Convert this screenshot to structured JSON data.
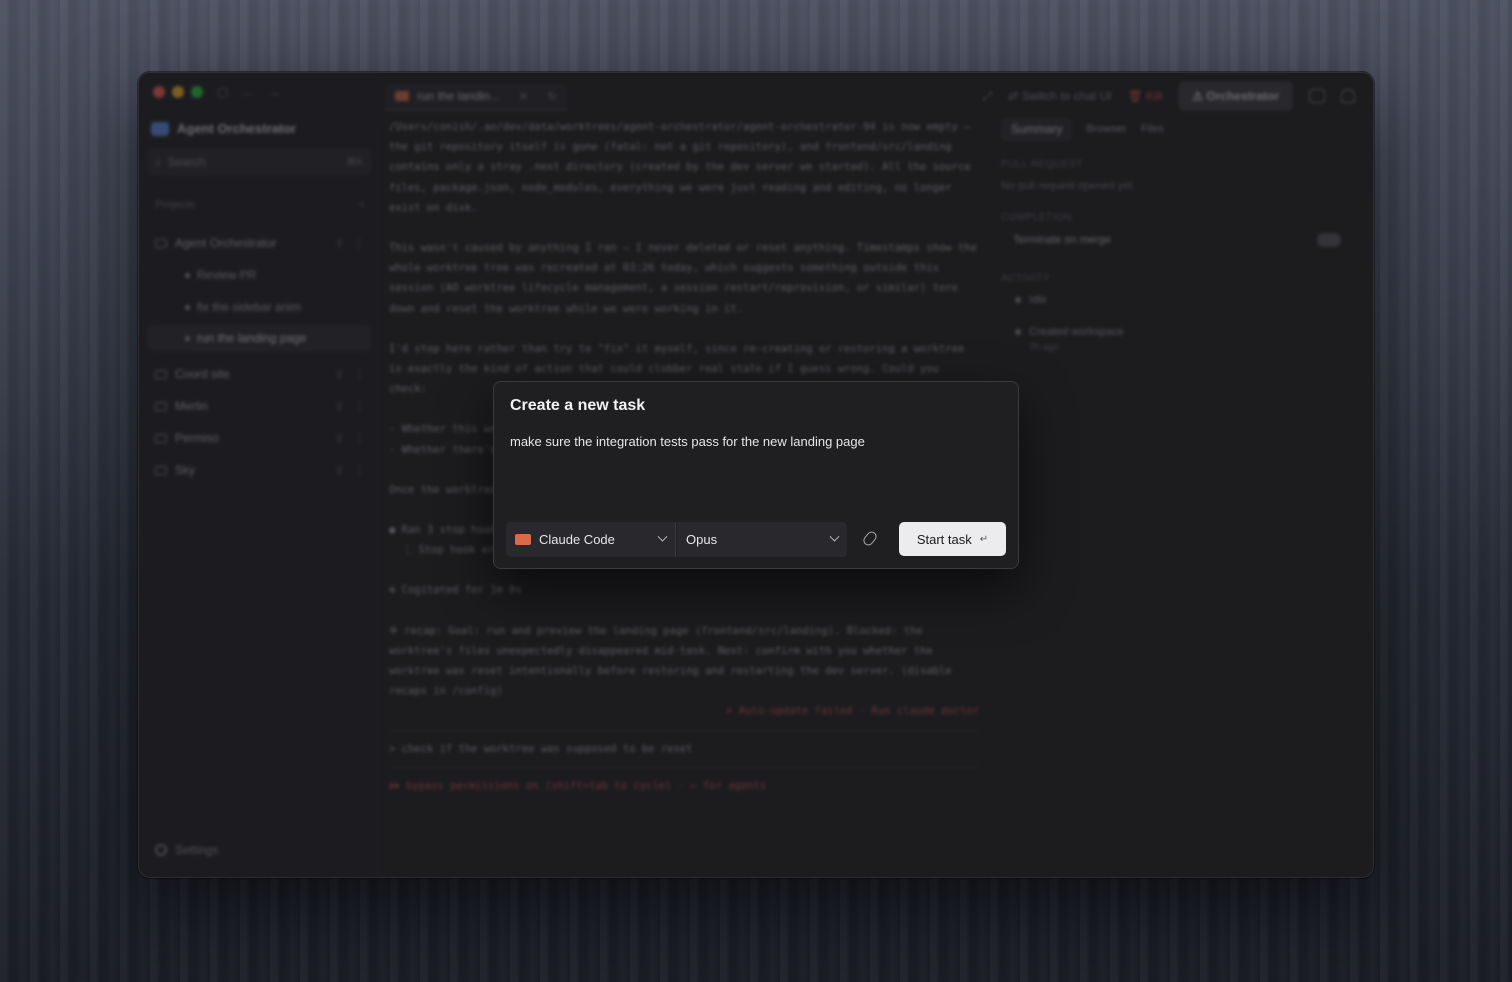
{
  "sidebar": {
    "brand": "Agent Orchestrator",
    "search_label": "Search",
    "search_shortcut": "⌘K",
    "section": "Projects",
    "projects": [
      {
        "name": "Agent Orchestrator"
      },
      {
        "name": "Coord site"
      },
      {
        "name": "Merlin"
      },
      {
        "name": "Permiso"
      },
      {
        "name": "Sky"
      }
    ],
    "tasks": [
      "Review PR",
      "fix the sidebar anim",
      "run the landing page"
    ],
    "settings": "Settings"
  },
  "topbar": {
    "tab_label": "run the landin...",
    "switch_label": "Switch to chat UI",
    "kill_label": "Kill",
    "orchestrator_label": "Orchestrator"
  },
  "terminal": {
    "lines": [
      "/Users/conish/.ao/dev/data/worktrees/agent-orchestrator/agent-orchestrator-94 is now empty — the git repository itself is gone (fatal: not a git repository), and frontend/src/landing contains only a stray .next directory (created by the dev server we started). All the source files, package.json, node_modules, everything we were just reading and editing, no longer exist on disk.",
      "This wasn't caused by anything I ran — I never deleted or reset anything. Timestamps show the whole worktree tree was recreated at 03:26 today, which suggests something outside this session (AO worktree lifecycle management, a session restart/reprovision, or similar) tore down and reset the worktree while we were working in it.",
      "I'd stop here rather than try to \"fix\" it myself, since re-creating or restoring a worktree is exactly the kind of action that could clobber real state if I guess wrong. Could you check:",
      "- Whether this worktree was intentionally reset by you or the orchestrator\n- Whether there's a backup",
      "Once the worktree is restored, I can restart next dev",
      "● Ran 3 stop hooks\n  ⎿ Stop hook error: Failed with non-blocking status code: /bin/sh: ao: command not found",
      "✻ Cogitated for 1m 0s",
      "※ recap: Goal: run and preview the landing page (frontend/src/landing). Blocked: the worktree's files unexpectedly disappeared mid-task. Next: confirm with you whether the worktree was reset intentionally before restoring and restarting the dev server. (disable recaps in /config)"
    ],
    "warning": "✗ Auto-update failed · Run claude doctor",
    "prompt": "> check if the worktree was supposed to be reset",
    "footer": "⏵⏵ bypass permissions on (shift+tab to cycle) · ← for agents"
  },
  "panel": {
    "tabs": [
      "Summary",
      "Browser",
      "Files"
    ],
    "pr_label": "PULL REQUEST",
    "pr_value": "No pull request opened yet.",
    "completion_label": "COMPLETION",
    "terminate_label": "Terminate on merge",
    "activity_label": "ACTIVITY",
    "activity": [
      "Idle",
      "Created workspace"
    ],
    "activity_time": "3h ago"
  },
  "modal": {
    "title": "Create a new task",
    "input_value": "make sure the integration tests pass for the new landing page",
    "agent": "Claude Code",
    "model": "Opus",
    "start_label": "Start task",
    "enter_glyph": "↵"
  }
}
